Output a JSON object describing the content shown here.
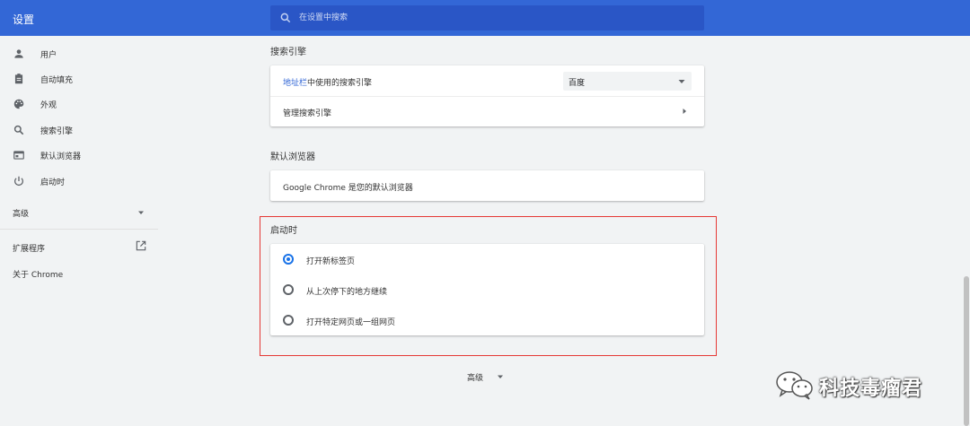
{
  "app": {
    "title": "设置"
  },
  "search": {
    "placeholder": "在设置中搜索"
  },
  "sidebar": {
    "items": [
      {
        "label": "用户",
        "icon": "person-icon"
      },
      {
        "label": "自动填充",
        "icon": "clipboard-icon"
      },
      {
        "label": "外观",
        "icon": "palette-icon"
      },
      {
        "label": "搜索引擎",
        "icon": "search-icon"
      },
      {
        "label": "默认浏览器",
        "icon": "browser-icon"
      },
      {
        "label": "启动时",
        "icon": "power-icon"
      }
    ],
    "advanced": "高级",
    "extensions": "扩展程序",
    "about": "关于 Chrome"
  },
  "search_engine": {
    "title": "搜索引擎",
    "row1_link": "地址栏",
    "row1_text": "中使用的搜索引擎",
    "selected_engine": "百度",
    "row2": "管理搜索引擎"
  },
  "default_browser": {
    "title": "默认浏览器",
    "status": "Google Chrome 是您的默认浏览器"
  },
  "startup": {
    "title": "启动时",
    "options": [
      {
        "label": "打开新标签页",
        "checked": true
      },
      {
        "label": "从上次停下的地方继续",
        "checked": false
      },
      {
        "label": "打开特定网页或一组网页",
        "checked": false
      }
    ]
  },
  "advanced_bottom": "高级",
  "watermark": {
    "text": "科技毒瘤君"
  },
  "colors": {
    "header": "#3367d6",
    "accent": "#1a73e8",
    "highlight": "#e53935",
    "background": "#f1f3f4"
  }
}
